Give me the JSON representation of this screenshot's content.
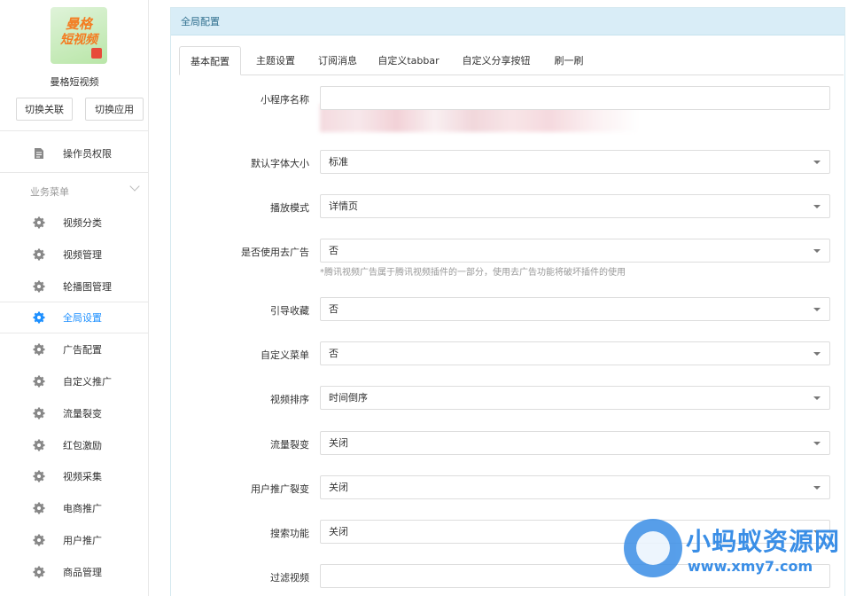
{
  "app": {
    "logo_line1": "曼格",
    "logo_line2": "短视频",
    "name": "曼格短视频",
    "switch_link": "切换关联",
    "switch_app": "切换应用"
  },
  "sidebar": {
    "top_item": {
      "label": "操作员权限",
      "icon": "document-icon"
    },
    "group_title": "业务菜单",
    "items": [
      {
        "label": "视频分类",
        "icon": "gear-icon",
        "active": false
      },
      {
        "label": "视频管理",
        "icon": "gear-icon",
        "active": false
      },
      {
        "label": "轮播图管理",
        "icon": "gear-icon",
        "active": false
      },
      {
        "label": "全局设置",
        "icon": "gear-icon",
        "active": true
      },
      {
        "label": "广告配置",
        "icon": "gear-icon",
        "active": false
      },
      {
        "label": "自定义推广",
        "icon": "gear-icon",
        "active": false
      },
      {
        "label": "流量裂变",
        "icon": "gear-icon",
        "active": false
      },
      {
        "label": "红包激励",
        "icon": "gear-icon",
        "active": false
      },
      {
        "label": "视频采集",
        "icon": "gear-icon",
        "active": false
      },
      {
        "label": "电商推广",
        "icon": "gear-icon",
        "active": false
      },
      {
        "label": "用户推广",
        "icon": "gear-icon",
        "active": false
      },
      {
        "label": "商品管理",
        "icon": "gear-icon",
        "active": false
      }
    ]
  },
  "panel": {
    "title": "全局配置",
    "tabs": [
      "基本配置",
      "主题设置",
      "订阅消息",
      "自定义tabbar",
      "自定义分享按钮",
      "刷一刷"
    ],
    "active_tab": 0
  },
  "form": {
    "rows": [
      {
        "label": "小程序名称",
        "value": "",
        "type": "text"
      },
      {
        "label": "默认字体大小",
        "value": "标准",
        "type": "select"
      },
      {
        "label": "播放模式",
        "value": "详情页",
        "type": "select"
      },
      {
        "label": "是否使用去广告",
        "value": "否",
        "type": "select",
        "hint": "*腾讯视频广告属于腾讯视频插件的一部分，使用去广告功能将破坏插件的使用"
      },
      {
        "label": "引导收藏",
        "value": "否",
        "type": "select"
      },
      {
        "label": "自定义菜单",
        "value": "否",
        "type": "select"
      },
      {
        "label": "视频排序",
        "value": "时间倒序",
        "type": "select"
      },
      {
        "label": "流量裂变",
        "value": "关闭",
        "type": "select"
      },
      {
        "label": "用户推广裂变",
        "value": "关闭",
        "type": "select"
      },
      {
        "label": "搜索功能",
        "value": "关闭",
        "type": "select"
      },
      {
        "label": "过滤视频",
        "value": "",
        "type": "text"
      }
    ]
  },
  "watermark": {
    "title": "小蚂蚁资源网",
    "url": "www.xmy7.com"
  },
  "colors": {
    "accent": "#1e90ff",
    "panel_header_bg": "#d9edf7",
    "panel_header_text": "#31708f",
    "watermark": "#3a8ee6"
  }
}
